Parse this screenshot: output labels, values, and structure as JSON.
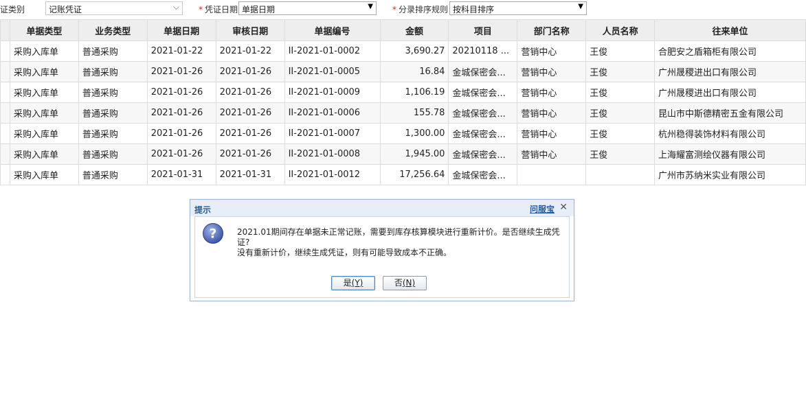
{
  "filters": {
    "voucher_type_label": "证类别",
    "voucher_type_value": "记账凭证",
    "voucher_date_label": "凭证日期",
    "voucher_date_value": "单据日期",
    "sort_rule_label": "分录排序规则",
    "sort_rule_value": "按科目排序",
    "required_mark": "*"
  },
  "table": {
    "headers": [
      "单据类型",
      "业务类型",
      "单据日期",
      "审核日期",
      "单据编号",
      "金额",
      "项目",
      "部门名称",
      "人员名称",
      "往来单位"
    ],
    "rows": [
      [
        "采购入库单",
        "普通采购",
        "2021-01-22",
        "2021-01-22",
        "II-2021-01-0002",
        "3,690.27",
        "20210118 ...",
        "营销中心",
        "王俊",
        "合肥安之盾箱柜有限公司"
      ],
      [
        "采购入库单",
        "普通采购",
        "2021-01-26",
        "2021-01-26",
        "II-2021-01-0005",
        "16.84",
        "金城保密会...",
        "营销中心",
        "王俊",
        "广州晟稷进出口有限公司"
      ],
      [
        "采购入库单",
        "普通采购",
        "2021-01-26",
        "2021-01-26",
        "II-2021-01-0009",
        "1,106.19",
        "金城保密会...",
        "营销中心",
        "王俊",
        "广州晟稷进出口有限公司"
      ],
      [
        "采购入库单",
        "普通采购",
        "2021-01-26",
        "2021-01-26",
        "II-2021-01-0006",
        "155.78",
        "金城保密会...",
        "营销中心",
        "王俊",
        "昆山市中斯德精密五金有限公司"
      ],
      [
        "采购入库单",
        "普通采购",
        "2021-01-26",
        "2021-01-26",
        "II-2021-01-0007",
        "1,300.00",
        "金城保密会...",
        "营销中心",
        "王俊",
        "杭州稳得装饰材料有限公司"
      ],
      [
        "采购入库单",
        "普通采购",
        "2021-01-26",
        "2021-01-26",
        "II-2021-01-0008",
        "1,945.00",
        "金城保密会...",
        "营销中心",
        "王俊",
        "上海耀富测绘仪器有限公司"
      ],
      [
        "采购入库单",
        "普通采购",
        "2021-01-31",
        "2021-01-31",
        "II-2021-01-0012",
        "17,256.64",
        "金城保密会...",
        "",
        "",
        "广州市苏纳米实业有限公司"
      ]
    ]
  },
  "dialog": {
    "title": "提示",
    "help_link": "问服宝",
    "close_glyph": "✕",
    "icon": "question-icon",
    "message_line1": "2021.01期间存在单据未正常记账，需要到库存核算模块进行重新计价。是否继续生成凭证?",
    "message_line2": "没有重新计价，继续生成凭证，则有可能导致成本不正确。",
    "yes_label": "是",
    "yes_key": "(Y)",
    "no_label": "否",
    "no_key": "(N)"
  }
}
